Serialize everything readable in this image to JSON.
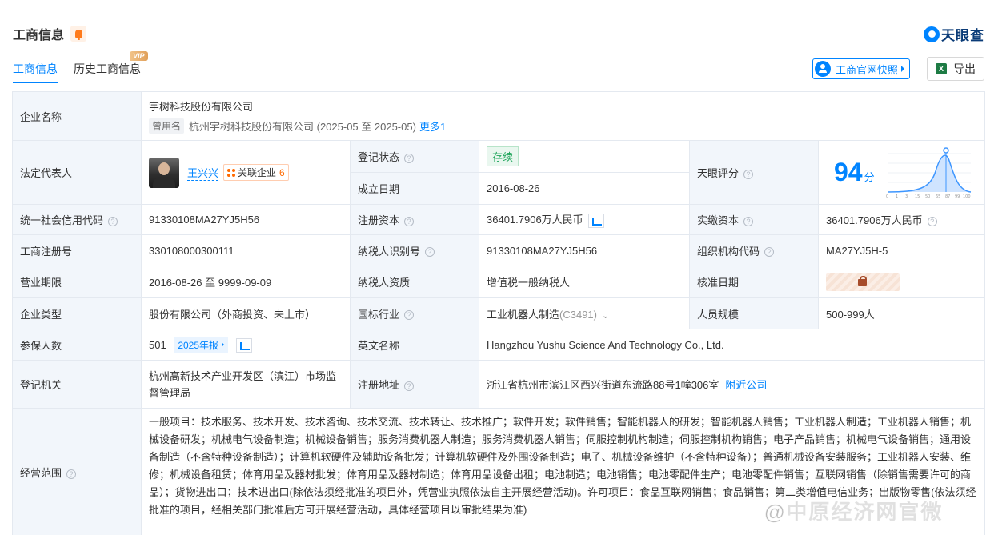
{
  "header": {
    "title": "工商信息",
    "brand": "天眼查"
  },
  "tabs": [
    {
      "label": "工商信息",
      "active": true
    },
    {
      "label": "历史工商信息",
      "badge": "VIP"
    }
  ],
  "actions": {
    "snapshot": "工商官网快照",
    "export": "导出"
  },
  "company": {
    "name_label": "企业名称",
    "name": "宇树科技股份有限公司",
    "former_tag": "曾用名",
    "former_name": "杭州宇树科技股份有限公司 (2025-05 至 2025-05)",
    "former_more": "更多1"
  },
  "rep": {
    "label": "法定代表人",
    "name": "王兴兴",
    "assoc_label": "关联企业",
    "assoc_count": "6"
  },
  "reg_status": {
    "label": "登记状态",
    "value": "存续"
  },
  "founded": {
    "label": "成立日期",
    "value": "2016-08-26"
  },
  "tianyan": {
    "label": "天眼评分",
    "score": "94",
    "unit": "分",
    "ticks": [
      "0",
      "1",
      "3",
      "15",
      "50",
      "65",
      "87",
      "99",
      "100"
    ]
  },
  "credit_code": {
    "label": "统一社会信用代码",
    "value": "91330108MA27YJ5H56"
  },
  "reg_capital": {
    "label": "注册资本",
    "value": "36401.7906万人民币"
  },
  "paid_capital": {
    "label": "实缴资本",
    "value": "36401.7906万人民币"
  },
  "reg_no": {
    "label": "工商注册号",
    "value": "330108000300111"
  },
  "taxpayer_id": {
    "label": "纳税人识别号",
    "value": "91330108MA27YJ5H56"
  },
  "org_code": {
    "label": "组织机构代码",
    "value": "MA27YJ5H-5"
  },
  "term": {
    "label": "营业期限",
    "value": "2016-08-26 至 9999-09-09"
  },
  "taxpayer_qual": {
    "label": "纳税人资质",
    "value": "增值税一般纳税人"
  },
  "approve_date": {
    "label": "核准日期"
  },
  "company_type": {
    "label": "企业类型",
    "value": "股份有限公司（外商投资、未上市）"
  },
  "industry": {
    "label": "国标行业",
    "value": "工业机器人制造",
    "code": "(C3491)"
  },
  "staff": {
    "label": "人员规模",
    "value": "500-999人"
  },
  "insured": {
    "label": "参保人数",
    "value": "501",
    "report": "2025年报"
  },
  "english_name": {
    "label": "英文名称",
    "value": "Hangzhou Yushu Science And Technology Co., Ltd."
  },
  "authority": {
    "label": "登记机关",
    "value": "杭州高新技术产业开发区（滨江）市场监督管理局"
  },
  "address": {
    "label": "注册地址",
    "value": "浙江省杭州市滨江区西兴街道东流路88号1幢306室",
    "nearby": "附近公司"
  },
  "scope": {
    "label": "经营范围",
    "value": "一般项目：技术服务、技术开发、技术咨询、技术交流、技术转让、技术推广；软件开发；软件销售；智能机器人的研发；智能机器人销售；工业机器人制造；工业机器人销售；机械设备研发；机械电气设备制造；机械设备销售；服务消费机器人制造；服务消费机器人销售；伺服控制机构制造；伺服控制机构销售；电子产品销售；机械电气设备销售；通用设备制造（不含特种设备制造）；计算机软硬件及辅助设备批发；计算机软硬件及外围设备制造；电子、机械设备维护（不含特种设备）；普通机械设备安装服务；工业机器人安装、维修；机械设备租赁；体育用品及器材批发；体育用品及器材制造；体育用品设备出租；电池制造；电池销售；电池零配件生产；电池零配件销售；互联网销售（除销售需要许可的商品）；货物进出口；技术进出口(除依法须经批准的项目外，凭营业执照依法自主开展经营活动)。许可项目：食品互联网销售；食品销售；第二类增值电信业务；出版物零售(依法须经批准的项目，经相关部门批准后方可开展经营活动，具体经营项目以审批结果为准)"
  },
  "watermark": "@中原经济网官微",
  "colors": {
    "accent": "#0084ff",
    "label_bg": "#f2f6fb",
    "status_green": "#1ea55a"
  }
}
